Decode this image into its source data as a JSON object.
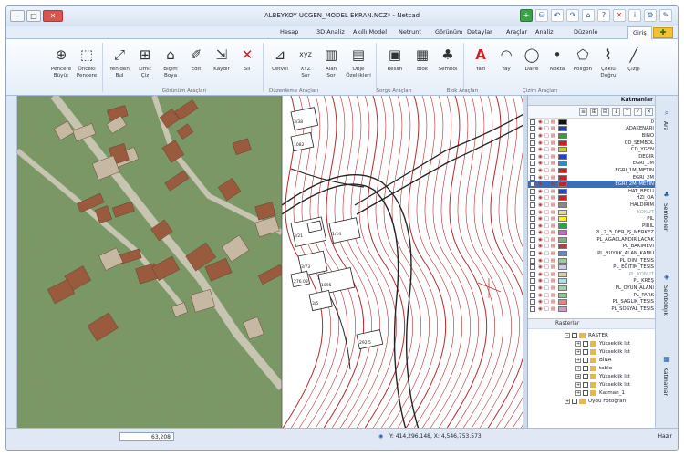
{
  "window": {
    "title": "ALBEYKOY UCGEN_MODEL EKRAN.NCZ* - Netcad",
    "controls": {
      "minimize": "–",
      "maximize": "□",
      "close": "✕"
    },
    "quick_access": [
      "+",
      "⛁",
      "↶",
      "↷",
      "⌂",
      "?",
      "✕",
      "i",
      "⚙",
      "✎"
    ]
  },
  "tabs": [
    "Giriş",
    "Düzenle",
    "Analiz",
    "Araçlar",
    "Detaylar",
    "Görünüm",
    "Netrunt",
    "Akıllı Model",
    "3D Analiz",
    "Hesap"
  ],
  "home_icon": "✚",
  "ribbon": {
    "buttons": [
      {
        "label": "Çizgi",
        "icon": "╱"
      },
      {
        "label": "Çoklu\nDoğru",
        "icon": "⌇"
      },
      {
        "label": "Poligon",
        "icon": "⬠"
      },
      {
        "label": "Nokta",
        "icon": "•"
      },
      {
        "label": "Daire",
        "icon": "◯"
      },
      {
        "label": "Yay",
        "icon": "◠"
      },
      {
        "label": "Yazı",
        "icon": "A"
      },
      {
        "label": "Sembol",
        "icon": "♣"
      },
      {
        "label": "Blok",
        "icon": "▦"
      },
      {
        "label": "Resim",
        "icon": "▣"
      },
      {
        "label": "Obje\nÖzellikleri",
        "icon": "▤"
      },
      {
        "label": "Alan\nSor",
        "icon": "▥"
      },
      {
        "label": "XYZ\nSor",
        "icon": "xyz"
      },
      {
        "label": "Cetvel",
        "icon": "⊿"
      },
      {
        "label": "Sil",
        "icon": "✕"
      },
      {
        "label": "Kaydır",
        "icon": "⇲"
      },
      {
        "label": "Edit",
        "icon": "✐"
      },
      {
        "label": "Biçim\nBoya",
        "icon": "⌂"
      },
      {
        "label": "Limit\nÇiz",
        "icon": "⊞"
      },
      {
        "label": "Yeniden\nBul",
        "icon": "⤢"
      },
      {
        "label": "Önceki\nPencere",
        "icon": "⬚"
      },
      {
        "label": "Pencere\nBüyüt",
        "icon": "⊕"
      }
    ],
    "groups": [
      "Çizim Araçları",
      "Blok Araçları",
      "Sorgu Araçları",
      "Düzenleme Araçları",
      "Görünüm Araçları"
    ]
  },
  "layers_panel": {
    "title": "Katmanlar",
    "tools": [
      "≡",
      "⊞",
      "⊟",
      "↓",
      "↑",
      "✓",
      "✕"
    ],
    "layers": [
      {
        "name": "0",
        "color": "#111111"
      },
      {
        "name": "ADAKENARI",
        "color": "#1f3fb8"
      },
      {
        "name": "BİNO",
        "color": "#3a9b3a"
      },
      {
        "name": "CD_SEMBOL",
        "color": "#cc2222"
      },
      {
        "name": "CD_YGEN",
        "color": "#cccc22"
      },
      {
        "name": "DEĞİR",
        "color": "#2244cc"
      },
      {
        "name": "EĞRİ_1M",
        "color": "#228ed6"
      },
      {
        "name": "EĞRİ_1M_METİN",
        "color": "#cc2222"
      },
      {
        "name": "EĞRİ_2M",
        "color": "#cc2222"
      },
      {
        "name": "EĞRİ_2M_METİN",
        "color": "#cc2222",
        "selected": true
      },
      {
        "name": "HAT_BEKLİ",
        "color": "#2244cc"
      },
      {
        "name": "HZİ_OA",
        "color": "#cc2222"
      },
      {
        "name": "HALDİRİM",
        "color": "#888888"
      },
      {
        "name": "KONUT",
        "color": "#ddddaa",
        "dim": true
      },
      {
        "name": "PİL",
        "color": "#ffee22"
      },
      {
        "name": "PİRİL",
        "color": "#22aa44"
      },
      {
        "name": "PL_2_3_DER_İŞ_MERKEZ",
        "color": "#cc66cc"
      },
      {
        "name": "PL_AGACLANDIRILACAK",
        "color": "#88aa88"
      },
      {
        "name": "PL_BAKIMEVİ",
        "color": "#aa4444"
      },
      {
        "name": "PL_BUYUK_ALAN_KAMU",
        "color": "#6688cc"
      },
      {
        "name": "PL_DINI_TESIS",
        "color": "#99cc99"
      },
      {
        "name": "PL_EGİTİM_TESİS",
        "color": "#ccccee"
      },
      {
        "name": "PL_KONUT",
        "color": "#ddccaa",
        "dim": true
      },
      {
        "name": "PL_KREŞ",
        "color": "#aaddee"
      },
      {
        "name": "PL_OYUN_ALANI",
        "color": "#aaccaa"
      },
      {
        "name": "PL_PARK",
        "color": "#88cc88"
      },
      {
        "name": "PL_SAGLIK_TESIS",
        "color": "#dd8888"
      },
      {
        "name": "PL_SOSYAL_TESIS",
        "color": "#cc99cc"
      }
    ]
  },
  "tree": {
    "header": "Rasterlar",
    "nodes": [
      {
        "label": "RASTER",
        "indent": 0,
        "pm": "-"
      },
      {
        "label": "Yükseklik lst",
        "indent": 1,
        "pm": "+"
      },
      {
        "label": "Yükseklik lst",
        "indent": 1,
        "pm": "+"
      },
      {
        "label": "BİNA",
        "indent": 1,
        "pm": "+"
      },
      {
        "label": "tablo",
        "indent": 1,
        "pm": "+"
      },
      {
        "label": "Yükseklik lst",
        "indent": 1,
        "pm": "+"
      },
      {
        "label": "Yükseklik lst",
        "indent": 1,
        "pm": "+"
      },
      {
        "label": "Katman_1",
        "indent": 1,
        "pm": "+"
      },
      {
        "label": "Uydu Fotoğrafı",
        "indent": 0,
        "pm": "+"
      }
    ]
  },
  "side_tabs": [
    "Ara",
    "Semboller",
    "Sembolojik",
    "Katmanlar"
  ],
  "status": {
    "left": "Hazır",
    "zoom": "63,208",
    "coords": "Y: 414,296.148, X: 4,546,753.573"
  },
  "parcel_labels": [
    "3/38",
    "1082",
    "3/21",
    "1/14",
    "3/73",
    "1095",
    "3/5",
    "276.03",
    "292.5"
  ]
}
